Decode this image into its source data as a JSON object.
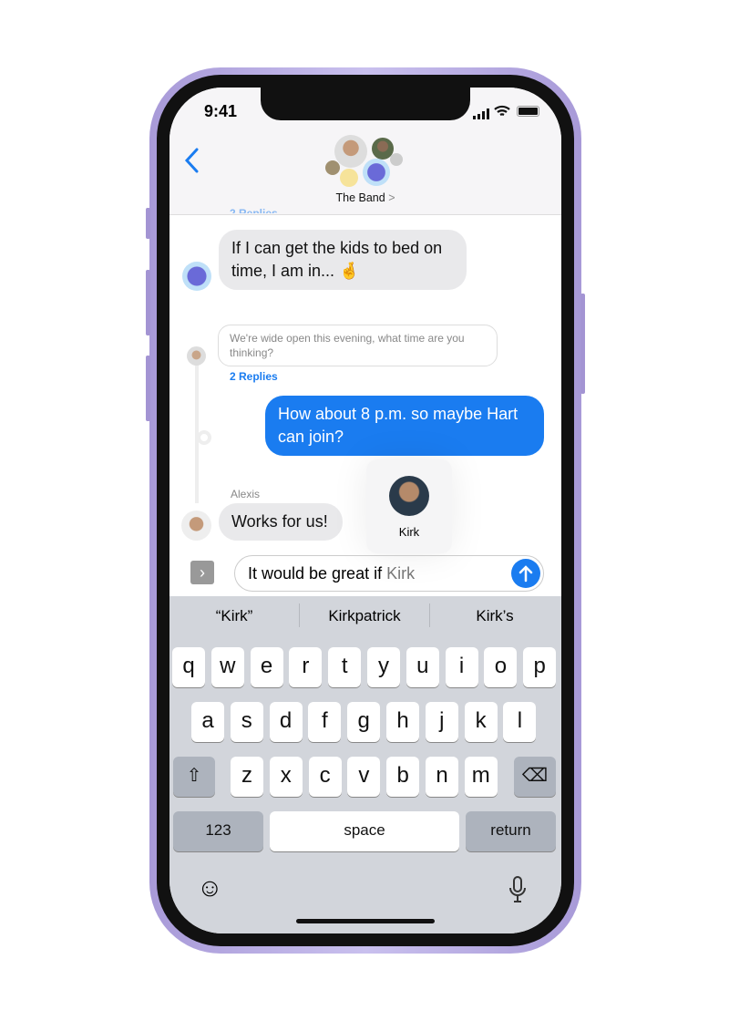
{
  "status": {
    "time": "9:41"
  },
  "header": {
    "title": "The Band",
    "chevron": ">"
  },
  "messages": {
    "cut_replies": "2 Replies",
    "m1": "If I can get the kids to bed on time, I am in... 🤞",
    "thread_quote": "We're wide open this evening, what time are you thinking?",
    "thread_replies": "2 Replies",
    "m2": "How about 8 p.m. so maybe Hart can join?",
    "sender": "Alexis",
    "m3": "Works for us!"
  },
  "mention": {
    "name": "Kirk"
  },
  "input": {
    "typed": "It would be great if ",
    "mention": "Kirk"
  },
  "suggestions": [
    "“Kirk”",
    "Kirkpatrick",
    "Kirk’s"
  ],
  "keyboard": {
    "row1": [
      "q",
      "w",
      "e",
      "r",
      "t",
      "y",
      "u",
      "i",
      "o",
      "p"
    ],
    "row2": [
      "a",
      "s",
      "d",
      "f",
      "g",
      "h",
      "j",
      "k",
      "l"
    ],
    "row3": [
      "z",
      "x",
      "c",
      "v",
      "b",
      "n",
      "m"
    ],
    "numbers": "123",
    "space": "space",
    "return": "return"
  },
  "colors": {
    "accent": "#1a7cf0",
    "frame": "#b0a4e0"
  }
}
